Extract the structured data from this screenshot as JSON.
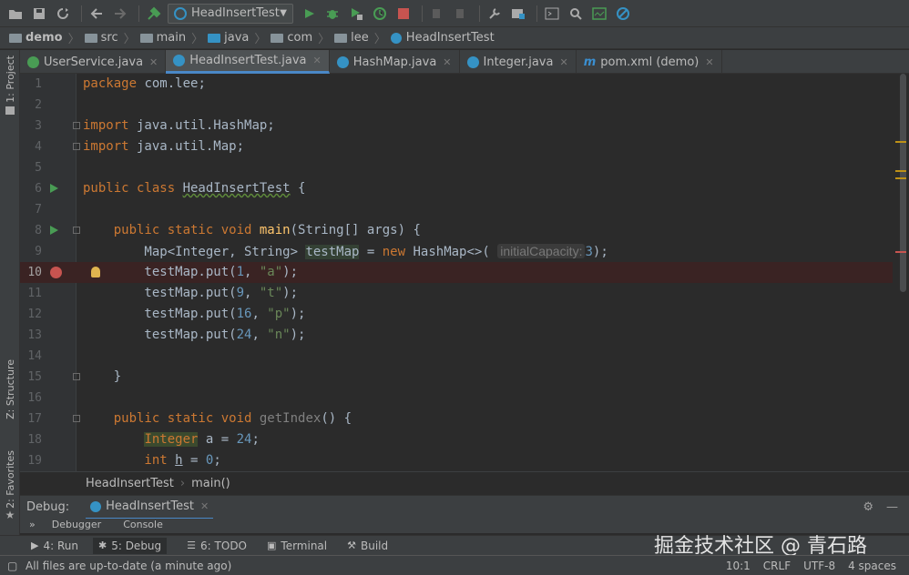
{
  "toolbar": {
    "run_config": "HeadInsertTest",
    "icons": [
      "open-icon",
      "save-icon",
      "sync-icon",
      "back-icon",
      "forward-icon",
      "build-icon",
      "run-icon",
      "debug-icon",
      "coverage-icon",
      "profile-icon",
      "stop-icon",
      "settings-icon",
      "structure-icon",
      "terminal-icon",
      "search-icon",
      "vcs-icon",
      "no-icon"
    ]
  },
  "breadcrumb": [
    "demo",
    "src",
    "main",
    "java",
    "com",
    "lee",
    "HeadInsertTest"
  ],
  "left_strip": {
    "project": "1: Project",
    "structure": "Z: Structure",
    "favorites": "2: Favorites"
  },
  "tabs": [
    {
      "label": "UserService.java",
      "color": "#499c54",
      "active": false
    },
    {
      "label": "HeadInsertTest.java",
      "color": "#3592c4",
      "active": true
    },
    {
      "label": "HashMap.java",
      "color": "#3592c4",
      "active": false
    },
    {
      "label": "Integer.java",
      "color": "#3592c4",
      "active": false
    },
    {
      "label": "pom.xml (demo)",
      "color": "#3a8fd1",
      "active": false
    }
  ],
  "editor": {
    "line_numbers": [
      "1",
      "2",
      "3",
      "4",
      "5",
      "6",
      "7",
      "8",
      "9",
      "10",
      "11",
      "12",
      "13",
      "14",
      "15",
      "16",
      "17",
      "18",
      "19"
    ],
    "current_line": "10",
    "breakpoint_line": "10"
  },
  "code": {
    "l1_kw": "package",
    "l1_rest": " com.lee;",
    "l3_kw": "import",
    "l3_rest": " java.util.HashMap;",
    "l4_kw": "import",
    "l4_rest": " java.util.Map;",
    "l6_kw": "public class ",
    "l6_name": "HeadInsertTest",
    "l6_rest": " {",
    "l8_kw": "    public static void ",
    "l8_fn": "main",
    "l8_rest": "(String[] args) {",
    "l9_a": "        Map<Integer, String> ",
    "l9_var": "testMap",
    "l9_b": " = ",
    "l9_new": "new",
    "l9_c": " HashMap<>( ",
    "l9_hint": "initialCapacity:",
    "l9_num": "3",
    "l9_end": ");",
    "l10_a": "        testMap.put(",
    "l10_num": "1",
    "l10_b": ", ",
    "l10_str": "\"a\"",
    "l10_end": ");",
    "l11_a": "        testMap.put(",
    "l11_num": "9",
    "l11_b": ", ",
    "l11_str": "\"t\"",
    "l11_end": ");",
    "l12_a": "        testMap.put(",
    "l12_num": "16",
    "l12_b": ", ",
    "l12_str": "\"p\"",
    "l12_end": ");",
    "l13_a": "        testMap.put(",
    "l13_num": "24",
    "l13_b": ", ",
    "l13_str": "\"n\"",
    "l13_end": ");",
    "l15": "    }",
    "l17_kw": "    public static void ",
    "l17_fn": "getIndex",
    "l17_rest": "() {",
    "l18_a": "        ",
    "l18_type": "Integer",
    "l18_b": " a = ",
    "l18_num": "24",
    "l18_end": ";",
    "l19_kw": "        int",
    "l19_b": " ",
    "l19_var": "h",
    "l19_c": " = ",
    "l19_num": "0",
    "l19_end": ";"
  },
  "editor_crumb": {
    "class": "HeadInsertTest",
    "method": "main()"
  },
  "debug": {
    "label": "Debug:",
    "session": "HeadInsertTest",
    "sub_debugger": "Debugger",
    "sub_console": "Console"
  },
  "bottom_tabs": [
    {
      "label": "4: Run",
      "icon": "▶",
      "active": false
    },
    {
      "label": "5: Debug",
      "icon": "✱",
      "active": true
    },
    {
      "label": "6: TODO",
      "icon": "☰",
      "active": false
    },
    {
      "label": "Terminal",
      "icon": "▣",
      "active": false
    },
    {
      "label": "Build",
      "icon": "⚒",
      "active": false
    }
  ],
  "status": {
    "message": "All files are up-to-date (a minute ago)",
    "position": "10:1",
    "line_sep": "CRLF",
    "encoding": "UTF-8",
    "indent": "4 spaces"
  },
  "watermark": "掘金技术社区 @ 青石路",
  "colors": {
    "accent": "#4a88c7",
    "keyword": "#cc7832",
    "string": "#6a8759",
    "number": "#6897bb"
  }
}
